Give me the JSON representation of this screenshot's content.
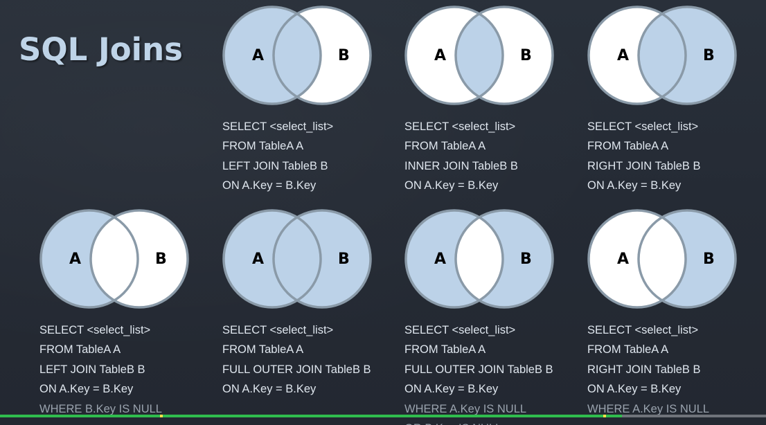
{
  "title": "SQL Joins",
  "colors": {
    "fill": "#bcd2e8",
    "empty": "#ffffff",
    "stroke": "#8a9aa8",
    "progress": "#2fbd4e",
    "marker": "#f3e04a"
  },
  "video": {
    "progress_fraction": 0.812
  },
  "joins": [
    {
      "a_label": "A",
      "b_label": "B",
      "shading": "left",
      "sql": [
        "SELECT <select_list>",
        "FROM TableA A",
        "LEFT JOIN TableB B",
        "ON A.Key = B.Key"
      ]
    },
    {
      "a_label": "A",
      "b_label": "B",
      "shading": "inner",
      "sql": [
        "SELECT <select_list>",
        "FROM TableA A",
        "INNER JOIN TableB B",
        "ON A.Key = B.Key"
      ]
    },
    {
      "a_label": "A",
      "b_label": "B",
      "shading": "right",
      "sql": [
        "SELECT <select_list>",
        "FROM TableA A",
        "RIGHT JOIN TableB B",
        "ON A.Key = B.Key"
      ]
    },
    {
      "a_label": "A",
      "b_label": "B",
      "shading": "left-only",
      "sql": [
        "SELECT <select_list>",
        "FROM TableA A",
        "LEFT JOIN TableB B",
        "ON A.Key = B.Key",
        "WHERE B.Key IS NULL"
      ]
    },
    {
      "a_label": "A",
      "b_label": "B",
      "shading": "full",
      "sql": [
        "SELECT <select_list>",
        "FROM TableA A",
        "FULL OUTER JOIN TableB B",
        "ON A.Key = B.Key"
      ]
    },
    {
      "a_label": "A",
      "b_label": "B",
      "shading": "outer-only",
      "sql": [
        "SELECT <select_list>",
        "FROM TableA A",
        "FULL OUTER JOIN TableB B",
        "ON A.Key = B.Key",
        "WHERE A.Key IS NULL",
        "OR B.Key IS NULL"
      ]
    },
    {
      "a_label": "A",
      "b_label": "B",
      "shading": "right-only",
      "sql": [
        "SELECT <select_list>",
        "FROM TableA A",
        "RIGHT JOIN TableB B",
        "ON A.Key = B.Key",
        "WHERE A.Key IS NULL"
      ]
    }
  ]
}
